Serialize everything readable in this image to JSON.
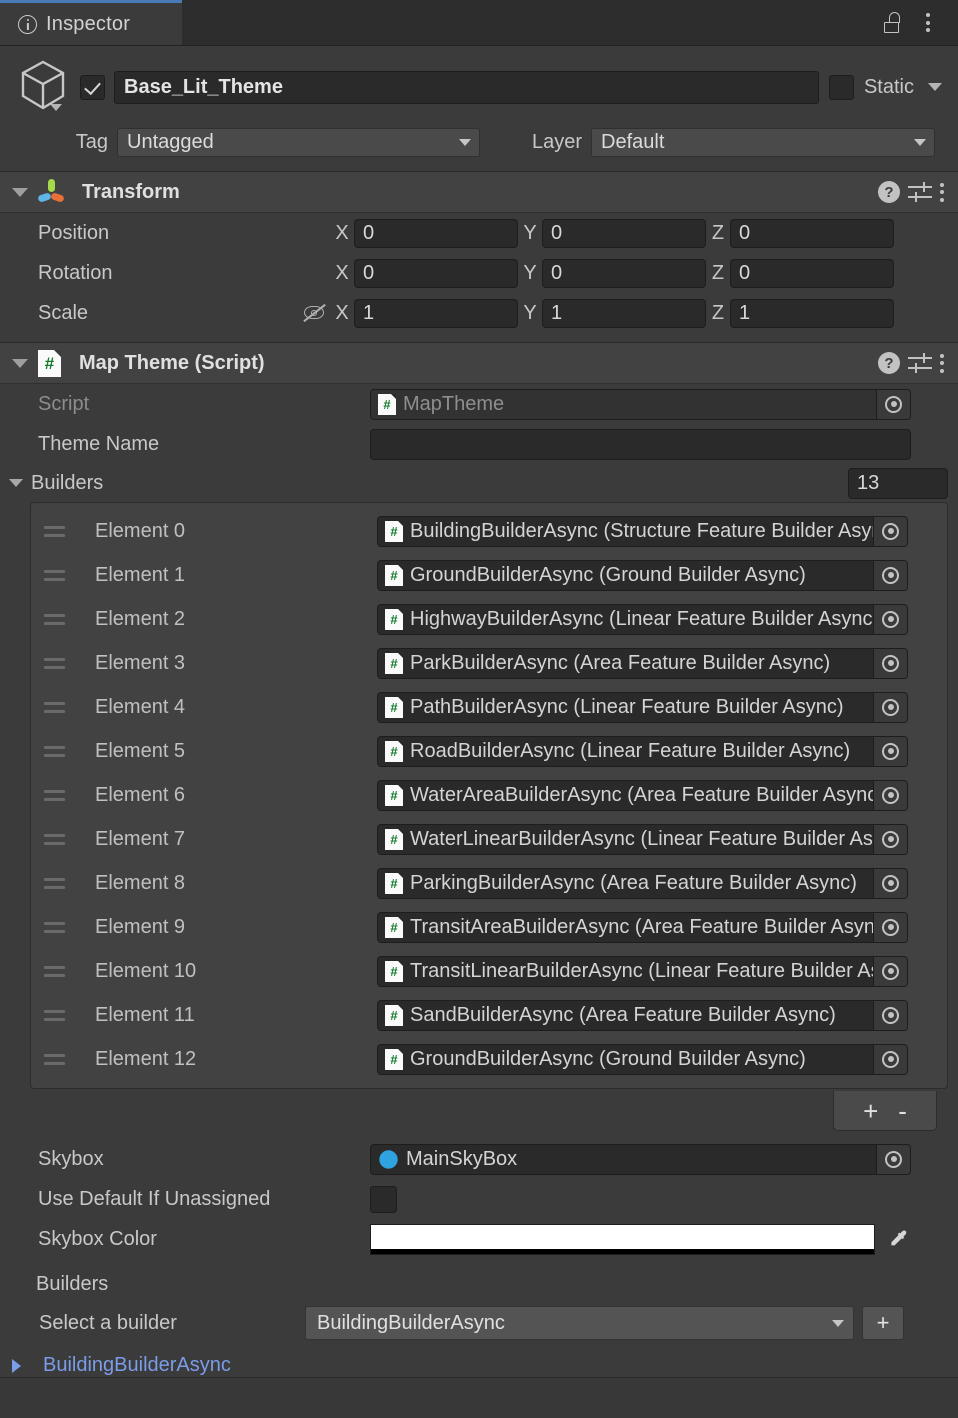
{
  "window": {
    "tab_label": "Inspector",
    "info_icon": "info-icon",
    "lock_icon": "lock-icon",
    "menu_icon": "kebab-menu-icon",
    "accent_color": "#4a7ab5",
    "background": "#383838"
  },
  "object_header": {
    "prefab_icon": "cube-prefab-icon",
    "enabled": true,
    "name": "Base_Lit_Theme",
    "static_label": "Static",
    "static_checked": false,
    "tag_label": "Tag",
    "tag_value": "Untagged",
    "layer_label": "Layer",
    "layer_value": "Default"
  },
  "transform": {
    "title": "Transform",
    "icon": "transform-axis-icon",
    "help_icon": "?",
    "rows": [
      {
        "label": "Position",
        "x": "0",
        "y": "0",
        "z": "0",
        "link": false
      },
      {
        "label": "Rotation",
        "x": "0",
        "y": "0",
        "z": "0",
        "link": false
      },
      {
        "label": "Scale",
        "x": "1",
        "y": "1",
        "z": "1",
        "link": true
      }
    ],
    "axis_labels": {
      "x": "X",
      "y": "Y",
      "z": "Z"
    }
  },
  "map_theme": {
    "title": "Map Theme (Script)",
    "script_label": "Script",
    "script_value": "MapTheme",
    "theme_name_label": "Theme Name",
    "theme_name_value": "",
    "builders_label": "Builders",
    "builders_count": "13",
    "elements": [
      {
        "label": "Element 0",
        "value": "BuildingBuilderAsync (Structure Feature Builder Async)"
      },
      {
        "label": "Element 1",
        "value": "GroundBuilderAsync (Ground Builder Async)"
      },
      {
        "label": "Element 2",
        "value": "HighwayBuilderAsync (Linear Feature Builder Async)"
      },
      {
        "label": "Element 3",
        "value": "ParkBuilderAsync (Area Feature Builder Async)"
      },
      {
        "label": "Element 4",
        "value": "PathBuilderAsync (Linear Feature Builder Async)"
      },
      {
        "label": "Element 5",
        "value": "RoadBuilderAsync (Linear Feature Builder Async)"
      },
      {
        "label": "Element 6",
        "value": "WaterAreaBuilderAsync (Area Feature Builder Async)"
      },
      {
        "label": "Element 7",
        "value": "WaterLinearBuilderAsync (Linear Feature Builder Async)"
      },
      {
        "label": "Element 8",
        "value": "ParkingBuilderAsync (Area Feature Builder Async)"
      },
      {
        "label": "Element 9",
        "value": "TransitAreaBuilderAsync (Area Feature Builder Async)"
      },
      {
        "label": "Element 10",
        "value": "TransitLinearBuilderAsync (Linear Feature Builder Async)"
      },
      {
        "label": "Element 11",
        "value": "SandBuilderAsync (Area Feature Builder Async)"
      },
      {
        "label": "Element 12",
        "value": "GroundBuilderAsync (Ground Builder Async)"
      }
    ],
    "add_label": "+",
    "remove_label": "-",
    "skybox_label": "Skybox",
    "skybox_value": "MainSkyBox",
    "skybox_icon": "material-sphere-icon",
    "use_default_label": "Use Default If Unassigned",
    "use_default_checked": false,
    "skybox_color_label": "Skybox Color",
    "skybox_color_value": "#ffffff",
    "skybox_color_alpha": "#000000",
    "eyedropper_icon": "eyedropper-icon"
  },
  "custom_editor": {
    "section_title": "Builders",
    "select_label": "Select a builder",
    "select_value": "BuildingBuilderAsync",
    "add_label": "+",
    "builder_entry": "BuildingBuilderAsync",
    "builder_entry_color": "#7b9ce8"
  }
}
